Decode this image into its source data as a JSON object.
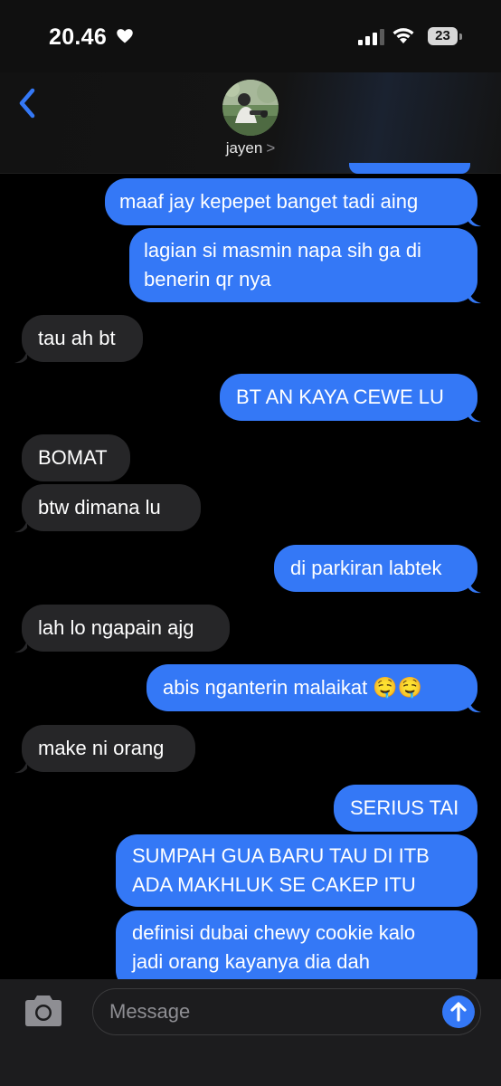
{
  "status_bar": {
    "time": "20.46",
    "battery": "23",
    "icons": [
      "heart-icon",
      "signal-icon",
      "wifi-icon",
      "battery-icon"
    ]
  },
  "header": {
    "contact_name": "jayen",
    "chevron": ">",
    "icons": [
      "back-chevron-icon",
      "contact-avatar"
    ]
  },
  "messages": [
    {
      "from": "me",
      "lines": [
        "maaf jay kepepet banget tadi aing"
      ]
    },
    {
      "from": "me",
      "lines": [
        "lagian si masmin napa sih ga di",
        "benerin qr nya"
      ]
    },
    {
      "from": "them",
      "lines": [
        "tau ah bt"
      ]
    },
    {
      "from": "me",
      "lines": [
        "BT AN KAYA CEWE LU"
      ]
    },
    {
      "from": "them",
      "lines": [
        "BOMAT"
      ]
    },
    {
      "from": "them",
      "lines": [
        "btw dimana lu"
      ]
    },
    {
      "from": "me",
      "lines": [
        "di parkiran labtek"
      ]
    },
    {
      "from": "them",
      "lines": [
        "lah lo ngapain ajg"
      ]
    },
    {
      "from": "me",
      "lines": [
        "abis nganterin malaikat 🤤🤤"
      ]
    },
    {
      "from": "them",
      "lines": [
        "make ni orang"
      ]
    },
    {
      "from": "me",
      "lines": [
        "SERIUS TAI"
      ]
    },
    {
      "from": "me",
      "lines": [
        "SUMPAH GUA BARU TAU DI ITB",
        "ADA MAKHLUK SE CAKEP ITU"
      ]
    },
    {
      "from": "me",
      "lines": [
        "definisi dubai chewy cookie kalo",
        "jadi orang kayanya dia dah"
      ]
    }
  ],
  "composer": {
    "placeholder": "Message",
    "icons": [
      "camera-icon",
      "send-arrow-icon"
    ]
  },
  "colors": {
    "sent_bubble": "#3478f6",
    "received_bubble": "#262628",
    "background": "#000000",
    "accent": "#3478f6"
  }
}
